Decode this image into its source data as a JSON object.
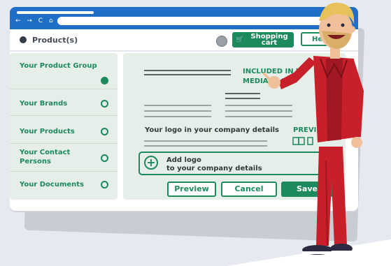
{
  "browser": {
    "nav_icons": "← → C ⌂"
  },
  "header": {
    "title": "Product(s)",
    "cart_label": "Shopping cart",
    "help_label": "He"
  },
  "sidebar": {
    "items": [
      {
        "label": "Your Product Group",
        "state": "active"
      },
      {
        "label": "Your Brands",
        "state": "open"
      },
      {
        "label": "Your Products",
        "state": "open"
      },
      {
        "label": "Your Contact Persons",
        "state": "open"
      },
      {
        "label": "Your Documents",
        "state": "open"
      }
    ]
  },
  "main": {
    "included_text": "INCLUDED IN Y… MEDIA PACK…",
    "included_line1": "INCLUDED IN Y",
    "included_line2": "MEDIA PACK",
    "logo_text": "Your logo in your company details",
    "preview_label": "PREVI",
    "add_logo_line1": "Add logo",
    "add_logo_line2": "to your company details"
  },
  "actions": {
    "preview": "Preview",
    "cancel": "Cancel",
    "save": "Save"
  },
  "colors": {
    "brand_green": "#1c8a5c",
    "browser_blue": "#1f6fc6",
    "panel_bg": "#e6eee9",
    "shirt_red": "#c8202a"
  },
  "icons": {
    "product": "circle-icon",
    "cart": "cart-icon",
    "add": "plus-icon",
    "book": "book-icon"
  }
}
